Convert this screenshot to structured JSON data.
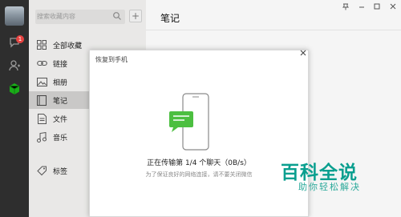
{
  "search": {
    "placeholder": "搜索收藏内容"
  },
  "rail": {
    "unread_badge": "1"
  },
  "sidebar": {
    "items": [
      {
        "label": "全部收藏",
        "icon": "grid-icon"
      },
      {
        "label": "链接",
        "icon": "link-icon"
      },
      {
        "label": "相册",
        "icon": "image-icon"
      },
      {
        "label": "笔记",
        "icon": "note-icon",
        "selected": true
      },
      {
        "label": "文件",
        "icon": "file-icon"
      },
      {
        "label": "音乐",
        "icon": "music-icon"
      },
      {
        "label": "标签",
        "icon": "tag-icon"
      }
    ]
  },
  "main": {
    "title": "笔记"
  },
  "dialog": {
    "title": "恢复到手机",
    "status": "正在传输第 1/4 个聊天（0B/s）",
    "substatus": "为了保证良好的网络连接，请不要关闭微信"
  },
  "watermark": {
    "line1": "百科全说",
    "line2": "助你轻松解决"
  },
  "colors": {
    "rail": "#2e2e2e",
    "sidebar": "#e9e8e7",
    "brand_green": "#1aad19",
    "badge": "#e64340",
    "watermark": "#0a9f8f"
  }
}
